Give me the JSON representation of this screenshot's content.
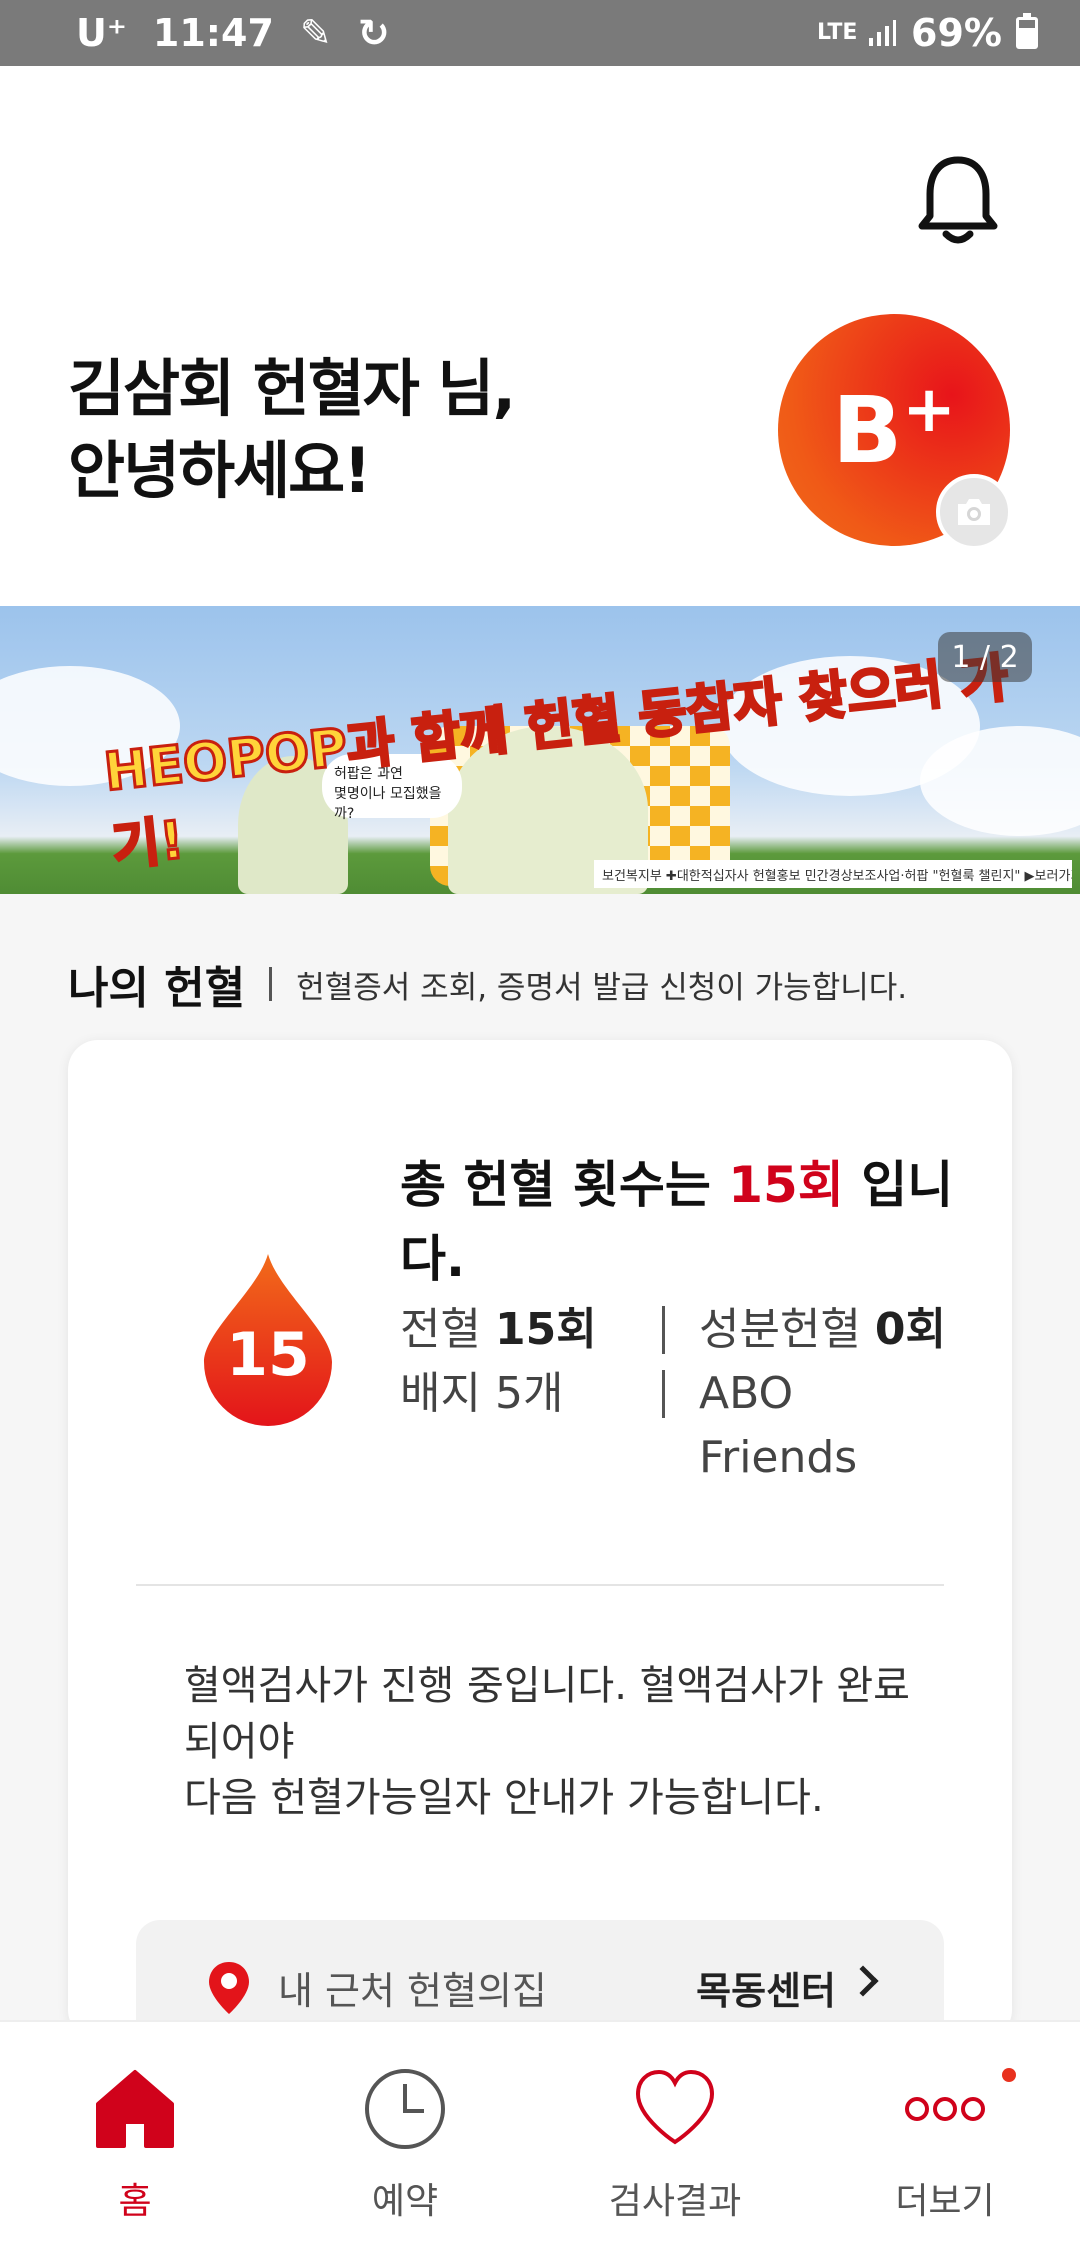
{
  "status_bar": {
    "carrier": "U⁺",
    "time": "11:47",
    "network": "LTE",
    "battery": "69%"
  },
  "header": {
    "greeting_line1": "김삼회 헌혈자 님,",
    "greeting_line2": "안녕하세요!",
    "blood_type": "B",
    "blood_type_sign": "+"
  },
  "banner": {
    "title": "HEOPOP과 함께 헌혈 동참자 찾으러 가기!",
    "speech_line1": "허팝은 과연",
    "speech_line2": "몇명이나 모집했을까?",
    "counter": "1 / 2",
    "footer": "보건복지부 ✚대한적십자사 헌혈홍보 민간경상보조사업·허팝 \"헌혈룩 챌린지\" ▶보러가기"
  },
  "my_donation": {
    "title": "나의 헌혈",
    "description": "헌혈증서 조회, 증명서 발급 신청이 가능합니다.",
    "drop_count": "15",
    "total_prefix": "총 헌혈 횟수는 ",
    "total_count": "15회",
    "total_suffix": " 입니다.",
    "whole_blood_label": "전혈 ",
    "whole_blood_count": "15",
    "apheresis_label": "성분헌혈 ",
    "apheresis_count": "0",
    "count_unit": "회",
    "badge_text": "배지 5개",
    "abo_text": "ABO Friends",
    "notice_line1": "혈액검사가 진행 중입니다. 혈액검사가 완료되어야",
    "notice_line2": "다음 헌혈가능일자 안내가 가능합니다.",
    "nearby_label": "내 근처 헌혈의집",
    "nearby_center": "목동센터"
  },
  "bottom_nav": {
    "home": "홈",
    "reservation": "예약",
    "results": "검사결과",
    "more": "더보기"
  },
  "colors": {
    "accent": "#d0021b",
    "avatar_orange": "#f26b1a",
    "avatar_red": "#e8141a"
  }
}
